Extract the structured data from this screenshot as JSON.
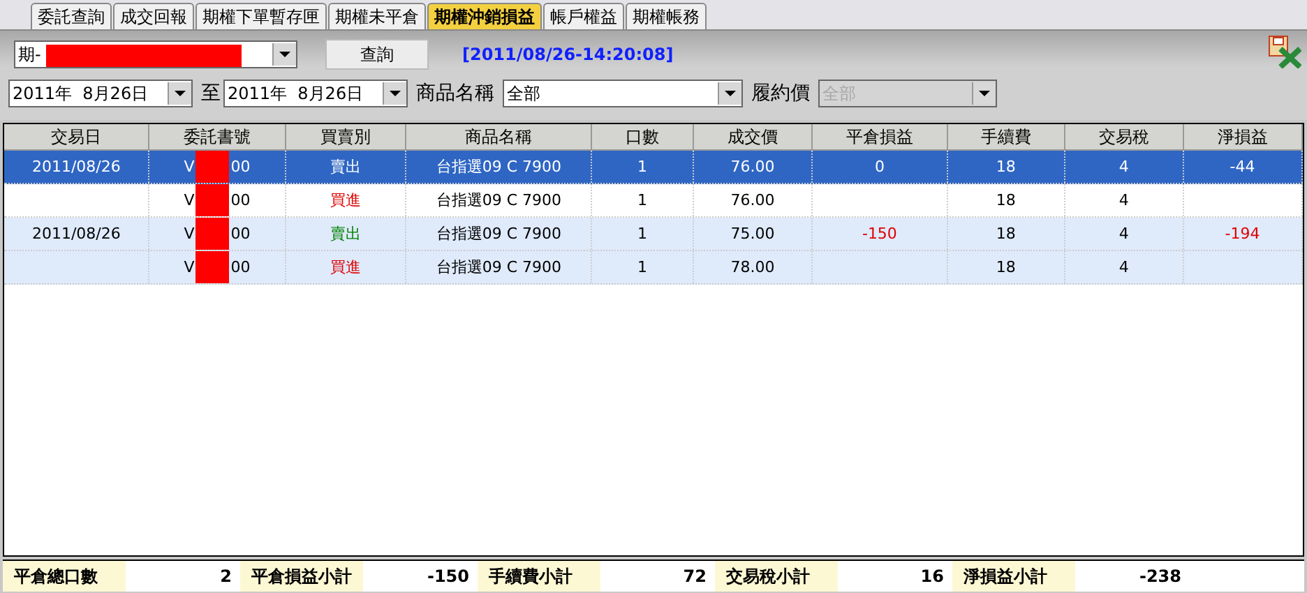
{
  "tabs": [
    {
      "label": "委託查詢",
      "selected": false
    },
    {
      "label": "成交回報",
      "selected": false
    },
    {
      "label": "期權下單暫存匣",
      "selected": false
    },
    {
      "label": "期權未平倉",
      "selected": false
    },
    {
      "label": "期權沖銷損益",
      "selected": true
    },
    {
      "label": "帳戶權益",
      "selected": false
    },
    {
      "label": "期權帳務",
      "selected": false
    }
  ],
  "account": {
    "value": "期-"
  },
  "query_button": "查詢",
  "timestamp": "[2011/08/26-14:20:08]",
  "date_from": "2011年  8月26日",
  "to_label": "至",
  "date_to": "2011年  8月26日",
  "product": {
    "label": "商品名稱",
    "value": "全部"
  },
  "strike": {
    "label": "履約價",
    "value": "全部",
    "disabled": true
  },
  "table": {
    "columns": [
      "交易日",
      "委託書號",
      "買賣別",
      "商品名稱",
      "口數",
      "成交價",
      "平倉損益",
      "手續費",
      "交易稅",
      "淨損益"
    ],
    "rows": [
      {
        "selected": true,
        "shaded": false,
        "date": "2011/08/26",
        "order_prefix": "V",
        "order_suffix": "00",
        "side": {
          "text": "賣出",
          "kind": "sell"
        },
        "product": "台指選09 C 7900",
        "qty": "1",
        "price": "76.00",
        "close_pnl": "0",
        "close_pnl_negative": false,
        "fee": "18",
        "tax": "4",
        "net": "-44",
        "net_negative": true
      },
      {
        "selected": false,
        "shaded": false,
        "order_prefix": "V",
        "order_suffix": "00",
        "side": {
          "text": "買進",
          "kind": "buy"
        },
        "product": "台指選09 C 7900",
        "qty": "1",
        "price": "76.00",
        "fee": "18",
        "tax": "4"
      },
      {
        "selected": false,
        "shaded": true,
        "date": "2011/08/26",
        "order_prefix": "V",
        "order_suffix": "00",
        "side": {
          "text": "賣出",
          "kind": "sell"
        },
        "product": "台指選09 C 7900",
        "qty": "1",
        "price": "75.00",
        "close_pnl": "-150",
        "close_pnl_negative": true,
        "fee": "18",
        "tax": "4",
        "net": "-194",
        "net_negative": true
      },
      {
        "selected": false,
        "shaded": true,
        "order_prefix": "V",
        "order_suffix": "00",
        "side": {
          "text": "買進",
          "kind": "buy"
        },
        "product": "台指選09 C 7900",
        "qty": "1",
        "price": "78.00",
        "fee": "18",
        "tax": "4"
      }
    ]
  },
  "summary": [
    {
      "label": "平倉總口數",
      "value": "2"
    },
    {
      "label": "平倉損益小計",
      "value": "-150"
    },
    {
      "label": "手續費小計",
      "value": "72"
    },
    {
      "label": "交易稅小計",
      "value": "16"
    },
    {
      "label": "淨損益小計",
      "value": "-238"
    }
  ]
}
